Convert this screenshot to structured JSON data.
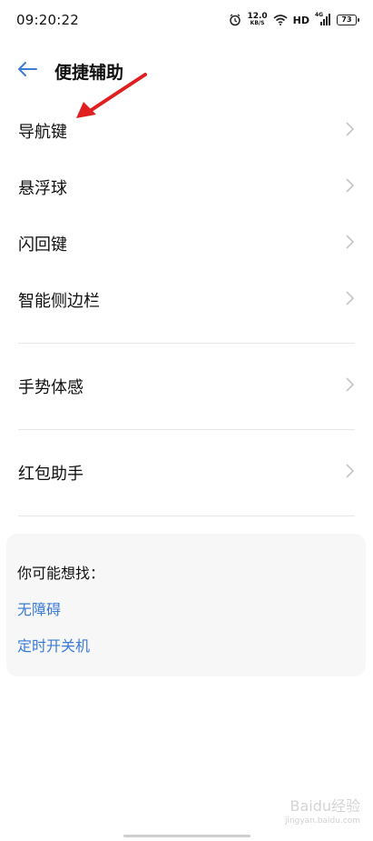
{
  "status_bar": {
    "time": "09:20:22",
    "net_speed_value": "12.0",
    "net_speed_unit": "KB/S",
    "hd": "HD",
    "network_type": "4G",
    "battery_level": "73"
  },
  "header": {
    "title": "便捷辅助"
  },
  "menu": {
    "items": [
      {
        "label": "导航键"
      },
      {
        "label": "悬浮球"
      },
      {
        "label": "闪回键"
      },
      {
        "label": "智能侧边栏"
      },
      {
        "label": "手势体感"
      },
      {
        "label": "红包助手"
      }
    ]
  },
  "suggestions": {
    "heading": "你可能想找：",
    "links": [
      {
        "label": "无障碍"
      },
      {
        "label": "定时开关机"
      }
    ]
  },
  "watermark": {
    "text": "Baidu经验",
    "url_text": "jingyan.baidu.com"
  },
  "colors": {
    "accent": "#3a7bd5",
    "annotation": "#e02020"
  }
}
